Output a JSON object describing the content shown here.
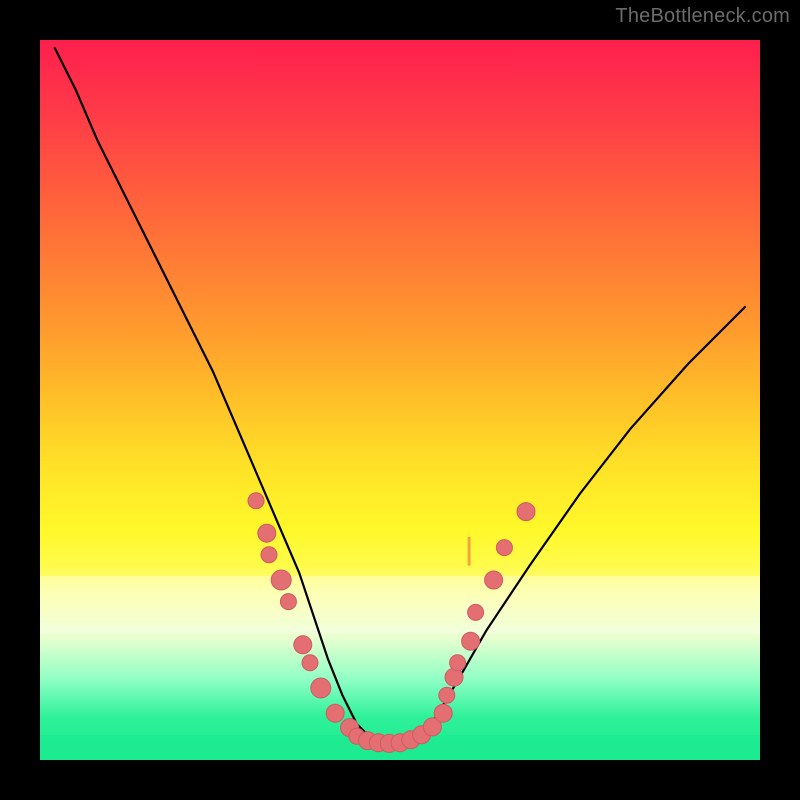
{
  "watermark": "TheBottleneck.com",
  "colors": {
    "curve": "#000000",
    "markers": "#e36f73",
    "marker_stroke": "#cf5a60",
    "frame": "#000000",
    "band_light": "rgba(255,255,255,0.35)",
    "band_green": "rgba(30,235,145,0.9)"
  },
  "chart_data": {
    "type": "line",
    "title": "",
    "xlabel": "",
    "ylabel": "",
    "xlim": [
      0,
      100
    ],
    "ylim": [
      0,
      100
    ],
    "grid": false,
    "gradient_stops": [
      {
        "pct": 0,
        "color": "#ff1f4e"
      },
      {
        "pct": 50,
        "color": "#ffc028"
      },
      {
        "pct": 75,
        "color": "#fffb4a"
      },
      {
        "pct": 100,
        "color": "#18e98e"
      }
    ],
    "series": [
      {
        "name": "bottleneck-curve",
        "x": [
          2,
          5,
          8,
          12,
          16,
          20,
          24,
          27,
          30,
          33,
          36,
          38,
          40,
          42,
          44,
          46,
          48,
          50,
          52,
          55,
          58,
          62,
          68,
          75,
          82,
          90,
          98
        ],
        "y": [
          99,
          93,
          86,
          78,
          70,
          62,
          54,
          47,
          40,
          33,
          26,
          20,
          14,
          9,
          5,
          3,
          2,
          2,
          3,
          6,
          11,
          18,
          27,
          37,
          46,
          55,
          63
        ]
      }
    ],
    "markers": [
      {
        "x": 30.0,
        "y": 36.0,
        "size": 8
      },
      {
        "x": 31.5,
        "y": 31.5,
        "size": 9
      },
      {
        "x": 31.8,
        "y": 28.5,
        "size": 8
      },
      {
        "x": 33.5,
        "y": 25.0,
        "size": 10
      },
      {
        "x": 34.5,
        "y": 22.0,
        "size": 8
      },
      {
        "x": 36.5,
        "y": 16.0,
        "size": 9
      },
      {
        "x": 37.5,
        "y": 13.5,
        "size": 8
      },
      {
        "x": 39.0,
        "y": 10.0,
        "size": 10
      },
      {
        "x": 41.0,
        "y": 6.5,
        "size": 9
      },
      {
        "x": 43.0,
        "y": 4.5,
        "size": 9
      },
      {
        "x": 44.0,
        "y": 3.3,
        "size": 8
      },
      {
        "x": 45.5,
        "y": 2.7,
        "size": 9
      },
      {
        "x": 47.0,
        "y": 2.4,
        "size": 9
      },
      {
        "x": 48.5,
        "y": 2.3,
        "size": 9
      },
      {
        "x": 50.0,
        "y": 2.4,
        "size": 9
      },
      {
        "x": 51.5,
        "y": 2.8,
        "size": 9
      },
      {
        "x": 53.0,
        "y": 3.5,
        "size": 9
      },
      {
        "x": 54.5,
        "y": 4.6,
        "size": 9
      },
      {
        "x": 56.0,
        "y": 6.5,
        "size": 9
      },
      {
        "x": 56.5,
        "y": 9.0,
        "size": 8
      },
      {
        "x": 57.5,
        "y": 11.5,
        "size": 9
      },
      {
        "x": 58.0,
        "y": 13.5,
        "size": 8
      },
      {
        "x": 59.8,
        "y": 16.5,
        "size": 9
      },
      {
        "x": 60.5,
        "y": 20.5,
        "size": 8
      },
      {
        "x": 63.0,
        "y": 25.0,
        "size": 9
      },
      {
        "x": 64.5,
        "y": 29.5,
        "size": 8
      },
      {
        "x": 67.5,
        "y": 34.5,
        "size": 9
      }
    ],
    "vertical_tick": {
      "x": 59.6,
      "y": 29.0,
      "length": 4
    },
    "pale_band": {
      "top_pct": 74.5,
      "height_pct": 8.0
    },
    "green_band": {
      "height_pct": 3.5
    }
  }
}
